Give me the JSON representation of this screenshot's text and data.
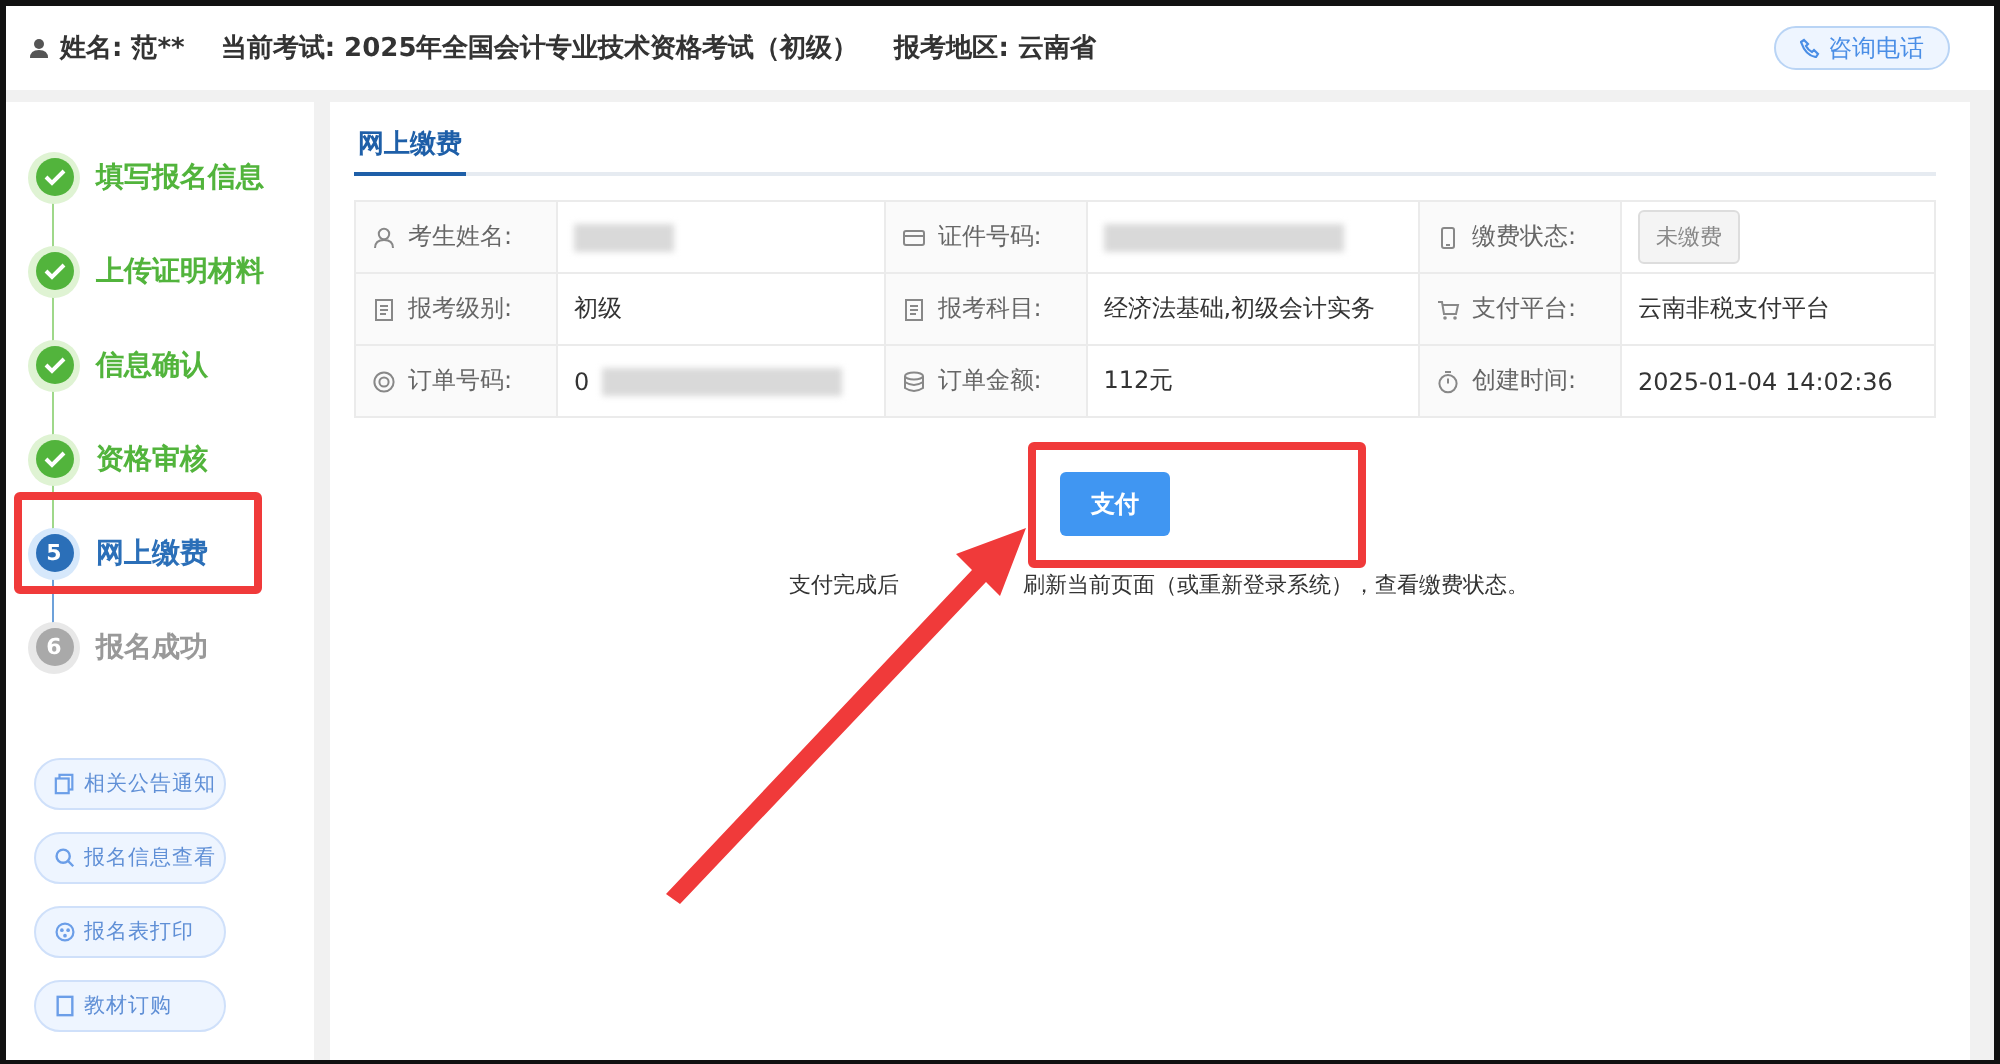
{
  "header": {
    "name": "姓名: 范**",
    "exam": "当前考试: 2025年全国会计专业技术资格考试（初级）",
    "region": "报考地区: 云南省",
    "contact_button": "咨询电话"
  },
  "steps": [
    {
      "label": "填写报名信息",
      "kind": "done"
    },
    {
      "label": "上传证明材料",
      "kind": "done"
    },
    {
      "label": "信息确认",
      "kind": "done"
    },
    {
      "label": "资格审核",
      "kind": "done"
    },
    {
      "label": "网上缴费",
      "kind": "current",
      "number": "5"
    },
    {
      "label": "报名成功",
      "kind": "pending",
      "number": "6"
    }
  ],
  "links": [
    "相关公告通知",
    "报名信息查看",
    "报名表打印",
    "教材订购"
  ],
  "panel": {
    "tab": "网上缴费",
    "fields": [
      {
        "label": "考生姓名:",
        "kind": "redacted"
      },
      {
        "label": "证件号码:",
        "kind": "redacted"
      },
      {
        "label": "缴费状态:",
        "kind": "tag",
        "value": "未缴费"
      },
      {
        "label": "报考级别:",
        "kind": "text",
        "value": "初级"
      },
      {
        "label": "报考科目:",
        "kind": "text",
        "value": "经济法基础,初级会计实务"
      },
      {
        "label": "支付平台:",
        "kind": "text",
        "value": "云南非税支付平台"
      },
      {
        "label": "订单号码:",
        "kind": "partial",
        "value": "0"
      },
      {
        "label": "订单金额:",
        "kind": "text",
        "value": "112元"
      },
      {
        "label": "创建时间:",
        "kind": "text",
        "value": "2025-01-04 14:02:36"
      }
    ],
    "pay_button": "支付",
    "note_parts": [
      "支付完成后",
      "刷新当前页面（或重新登录系统），查看缴费状态。"
    ]
  }
}
